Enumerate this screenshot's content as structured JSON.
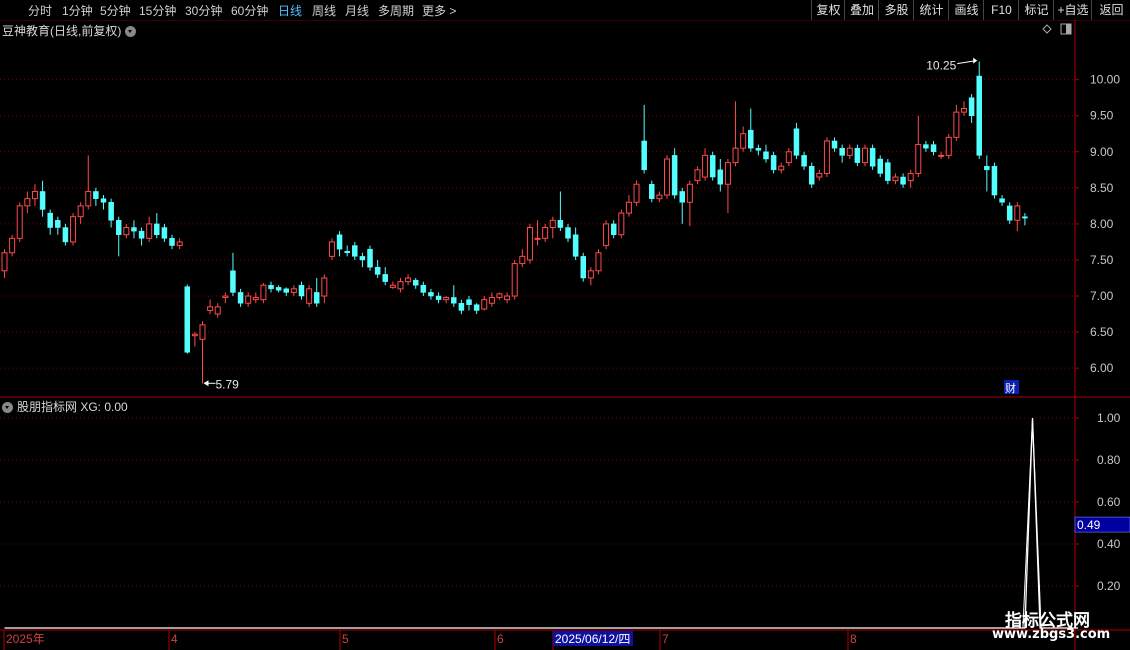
{
  "toolbar": {
    "periods": [
      "分时",
      "1分钟",
      "5分钟",
      "15分钟",
      "30分钟",
      "60分钟",
      "日线",
      "周线",
      "月线",
      "多周期",
      "更多 >"
    ],
    "active_period": "日线",
    "actions": [
      "复权",
      "叠加",
      "多股",
      "统计",
      "画线",
      "F10",
      "标记",
      "+自选",
      "返回"
    ]
  },
  "main_title": "豆神教育(日线,前复权)",
  "sub_title": "股朋指标网 XG: 0.00",
  "annotations": {
    "high_label": "10.25",
    "low_label": "5.79",
    "cai_badge": "财",
    "xg_value_box": "0.49"
  },
  "watermark": {
    "line1": "指标公式网",
    "line2": "www.zbgs3.com"
  },
  "colors": {
    "up": "#ff4a4a",
    "down": "#54ffff",
    "grid": "#7a0000",
    "axis": "#b00000",
    "line": "#ffffff",
    "value_box": "#0000a0"
  },
  "chart_data": [
    {
      "type": "candlestick",
      "title": "豆神教育(日线,前复权)",
      "ylim": [
        5.6,
        10.55
      ],
      "yticks": [
        "10.00",
        "9.50",
        "9.00",
        "8.50",
        "8.00",
        "7.50",
        "7.00",
        "6.50",
        "6.00"
      ],
      "x_labels": [
        "2025年",
        "4",
        "5",
        "6",
        "2025/06/12/四",
        "7",
        "8"
      ],
      "max_price": 10.25,
      "min_price": 5.79,
      "candles": [
        [
          7.35,
          7.6,
          7.65,
          7.25
        ],
        [
          7.6,
          7.8,
          7.85,
          7.55
        ],
        [
          7.8,
          8.25,
          8.3,
          7.75
        ],
        [
          8.25,
          8.35,
          8.45,
          8.15
        ],
        [
          8.35,
          8.45,
          8.55,
          8.25
        ],
        [
          8.45,
          8.2,
          8.6,
          8.1
        ],
        [
          8.15,
          7.95,
          8.2,
          7.85
        ],
        [
          8.05,
          7.95,
          8.1,
          7.85
        ],
        [
          7.95,
          7.75,
          8.0,
          7.7
        ],
        [
          7.75,
          8.1,
          8.15,
          7.7
        ],
        [
          8.1,
          8.25,
          8.3,
          8.0
        ],
        [
          8.25,
          8.45,
          8.95,
          8.2
        ],
        [
          8.45,
          8.35,
          8.5,
          8.25
        ],
        [
          8.35,
          8.3,
          8.4,
          8.2
        ],
        [
          8.3,
          8.05,
          8.35,
          7.95
        ],
        [
          8.05,
          7.85,
          8.1,
          7.55
        ],
        [
          7.85,
          7.95,
          8.0,
          7.8
        ],
        [
          7.95,
          7.9,
          8.05,
          7.8
        ],
        [
          7.9,
          7.8,
          7.95,
          7.7
        ],
        [
          7.8,
          8.0,
          8.1,
          7.75
        ],
        [
          8.0,
          7.85,
          8.15,
          7.8
        ],
        [
          7.95,
          7.8,
          8.0,
          7.75
        ],
        [
          7.8,
          7.7,
          7.85,
          7.65
        ],
        [
          7.7,
          7.75,
          7.8,
          7.65
        ],
        [
          7.13,
          6.22,
          7.16,
          6.2
        ],
        [
          6.45,
          6.47,
          6.5,
          6.3
        ],
        [
          6.4,
          6.6,
          6.65,
          5.79
        ],
        [
          6.8,
          6.85,
          6.95,
          6.75
        ],
        [
          6.75,
          6.85,
          6.9,
          6.7
        ],
        [
          6.98,
          7.0,
          7.05,
          6.9
        ],
        [
          7.35,
          7.05,
          7.6,
          7.0
        ],
        [
          7.05,
          6.9,
          7.1,
          6.85
        ],
        [
          6.9,
          7.0,
          7.05,
          6.85
        ],
        [
          6.95,
          6.98,
          7.05,
          6.9
        ],
        [
          6.95,
          7.15,
          7.18,
          6.9
        ],
        [
          7.15,
          7.1,
          7.2,
          7.05
        ],
        [
          7.12,
          7.08,
          7.15,
          7.05
        ],
        [
          7.1,
          7.05,
          7.12,
          7.0
        ],
        [
          7.05,
          7.1,
          7.15,
          7.0
        ],
        [
          7.15,
          7.0,
          7.2,
          6.95
        ],
        [
          6.9,
          7.1,
          7.15,
          6.85
        ],
        [
          7.05,
          6.9,
          7.25,
          6.85
        ],
        [
          7.0,
          7.25,
          7.3,
          6.9
        ],
        [
          7.55,
          7.75,
          7.8,
          7.5
        ],
        [
          7.85,
          7.65,
          7.9,
          7.55
        ],
        [
          7.62,
          7.6,
          7.7,
          7.55
        ],
        [
          7.7,
          7.55,
          7.75,
          7.5
        ],
        [
          7.55,
          7.5,
          7.6,
          7.4
        ],
        [
          7.65,
          7.4,
          7.7,
          7.35
        ],
        [
          7.4,
          7.3,
          7.5,
          7.25
        ],
        [
          7.3,
          7.2,
          7.4,
          7.15
        ],
        [
          7.12,
          7.15,
          7.2,
          7.1
        ],
        [
          7.1,
          7.2,
          7.25,
          7.05
        ],
        [
          7.2,
          7.25,
          7.3,
          7.15
        ],
        [
          7.22,
          7.15,
          7.25,
          7.1
        ],
        [
          7.15,
          7.05,
          7.2,
          7.0
        ],
        [
          7.05,
          7.0,
          7.1,
          6.95
        ],
        [
          7.0,
          6.95,
          7.05,
          6.9
        ],
        [
          6.95,
          6.98,
          7.0,
          6.9
        ],
        [
          6.98,
          6.9,
          7.15,
          6.85
        ],
        [
          6.9,
          6.8,
          6.95,
          6.75
        ],
        [
          6.95,
          6.88,
          7.0,
          6.8
        ],
        [
          6.88,
          6.8,
          6.9,
          6.75
        ],
        [
          6.82,
          6.95,
          7.0,
          6.8
        ],
        [
          6.9,
          6.98,
          7.05,
          6.85
        ],
        [
          6.98,
          7.03,
          7.05,
          6.95
        ],
        [
          6.95,
          7.0,
          7.05,
          6.9
        ],
        [
          7.0,
          7.45,
          7.5,
          6.95
        ],
        [
          7.45,
          7.55,
          7.65,
          7.4
        ],
        [
          7.5,
          7.95,
          8.0,
          7.45
        ],
        [
          7.8,
          7.8,
          8.05,
          7.7
        ],
        [
          7.8,
          7.95,
          8.0,
          7.75
        ],
        [
          7.95,
          8.05,
          8.1,
          7.8
        ],
        [
          8.05,
          7.95,
          8.45,
          7.9
        ],
        [
          7.95,
          7.8,
          8.0,
          7.75
        ],
        [
          7.85,
          7.55,
          7.95,
          7.5
        ],
        [
          7.55,
          7.25,
          7.6,
          7.2
        ],
        [
          7.25,
          7.35,
          7.4,
          7.15
        ],
        [
          7.35,
          7.6,
          7.65,
          7.3
        ],
        [
          7.7,
          8.0,
          8.05,
          7.65
        ],
        [
          8.0,
          7.85,
          8.05,
          7.8
        ],
        [
          7.85,
          8.15,
          8.2,
          7.8
        ],
        [
          8.15,
          8.3,
          8.4,
          8.1
        ],
        [
          8.3,
          8.55,
          8.6,
          8.25
        ],
        [
          9.15,
          8.75,
          9.65,
          8.7
        ],
        [
          8.55,
          8.35,
          8.6,
          8.3
        ],
        [
          8.35,
          8.4,
          8.45,
          8.3
        ],
        [
          8.4,
          8.9,
          8.95,
          8.35
        ],
        [
          8.95,
          8.4,
          9.05,
          8.35
        ],
        [
          8.45,
          8.3,
          8.5,
          8.0
        ],
        [
          8.3,
          8.55,
          8.6,
          7.97
        ],
        [
          8.6,
          8.75,
          8.8,
          8.55
        ],
        [
          8.65,
          8.95,
          9.05,
          8.6
        ],
        [
          8.95,
          8.65,
          9.0,
          8.6
        ],
        [
          8.75,
          8.55,
          8.9,
          8.45
        ],
        [
          8.55,
          8.85,
          8.9,
          8.15
        ],
        [
          8.85,
          9.05,
          9.7,
          8.8
        ],
        [
          9.05,
          9.25,
          9.35,
          9.0
        ],
        [
          9.3,
          9.05,
          9.6,
          9.0
        ],
        [
          9.05,
          9.02,
          9.1,
          8.95
        ],
        [
          9.0,
          8.9,
          9.1,
          8.85
        ],
        [
          8.95,
          8.75,
          9.0,
          8.7
        ],
        [
          8.75,
          8.8,
          8.85,
          8.7
        ],
        [
          8.85,
          9.0,
          9.05,
          8.8
        ],
        [
          9.32,
          8.95,
          9.4,
          8.9
        ],
        [
          8.95,
          8.8,
          9.0,
          8.75
        ],
        [
          8.8,
          8.55,
          8.85,
          8.5
        ],
        [
          8.65,
          8.7,
          8.75,
          8.6
        ],
        [
          8.7,
          9.15,
          9.2,
          8.65
        ],
        [
          9.15,
          9.05,
          9.2,
          9.0
        ],
        [
          9.05,
          8.95,
          9.1,
          8.85
        ],
        [
          8.95,
          9.05,
          9.1,
          8.9
        ],
        [
          9.05,
          8.85,
          9.1,
          8.8
        ],
        [
          8.85,
          9.05,
          9.1,
          8.8
        ],
        [
          9.05,
          8.8,
          9.1,
          8.75
        ],
        [
          8.9,
          8.7,
          8.95,
          8.65
        ],
        [
          8.85,
          8.6,
          8.9,
          8.55
        ],
        [
          8.6,
          8.65,
          8.7,
          8.55
        ],
        [
          8.65,
          8.55,
          8.7,
          8.5
        ],
        [
          8.6,
          8.7,
          8.75,
          8.5
        ],
        [
          8.7,
          9.1,
          9.5,
          8.65
        ],
        [
          9.1,
          9.05,
          9.15,
          9.0
        ],
        [
          9.1,
          9.0,
          9.15,
          8.95
        ],
        [
          8.95,
          8.95,
          9.0,
          8.9
        ],
        [
          8.95,
          9.2,
          9.25,
          8.9
        ],
        [
          9.2,
          9.55,
          9.65,
          9.15
        ],
        [
          9.55,
          9.6,
          9.7,
          9.5
        ],
        [
          9.75,
          9.5,
          9.8,
          9.4
        ],
        [
          10.05,
          8.95,
          10.25,
          8.9
        ],
        [
          8.8,
          8.75,
          8.95,
          8.45
        ],
        [
          8.8,
          8.4,
          8.85,
          8.35
        ],
        [
          8.35,
          8.3,
          8.4,
          8.25
        ],
        [
          8.25,
          8.05,
          8.3,
          8.0
        ],
        [
          8.05,
          8.25,
          8.3,
          7.9
        ],
        [
          8.1,
          8.08,
          8.15,
          7.98
        ]
      ]
    },
    {
      "type": "line",
      "title": "股朋指标网 XG: 0.00",
      "ylim": [
        0.0,
        1.1
      ],
      "yticks": [
        "1.00",
        "0.80",
        "0.60",
        "0.40",
        "0.20"
      ],
      "current_value": 0.49,
      "values": [
        0,
        0,
        0,
        0,
        0,
        0,
        0,
        0,
        0,
        0,
        0,
        0,
        0,
        0,
        0,
        0,
        0,
        0,
        0,
        0,
        0,
        0,
        0,
        0,
        0,
        0,
        0,
        0,
        0,
        0,
        0,
        0,
        0,
        0,
        0,
        0,
        0,
        0,
        0,
        0,
        0,
        0,
        0,
        0,
        0,
        0,
        0,
        0,
        0,
        0,
        0,
        0,
        0,
        0,
        0,
        0,
        0,
        0,
        0,
        0,
        0,
        0,
        0,
        0,
        0,
        0,
        0,
        0,
        0,
        0,
        0,
        0,
        0,
        0,
        0,
        0,
        0,
        0,
        0,
        0,
        0,
        0,
        0,
        0,
        0,
        0,
        0,
        0,
        0,
        0,
        0,
        0,
        0,
        0,
        0,
        0,
        0,
        0,
        0,
        0,
        0,
        0,
        0,
        0,
        0,
        0,
        0,
        0,
        0,
        0,
        0,
        0,
        0,
        0,
        0,
        0,
        0,
        0,
        0,
        0,
        0,
        0,
        0,
        0,
        0,
        0,
        0,
        0,
        0,
        0,
        0,
        0,
        0,
        0,
        0,
        1,
        0,
        0,
        0,
        0,
        0,
        0
      ]
    }
  ]
}
